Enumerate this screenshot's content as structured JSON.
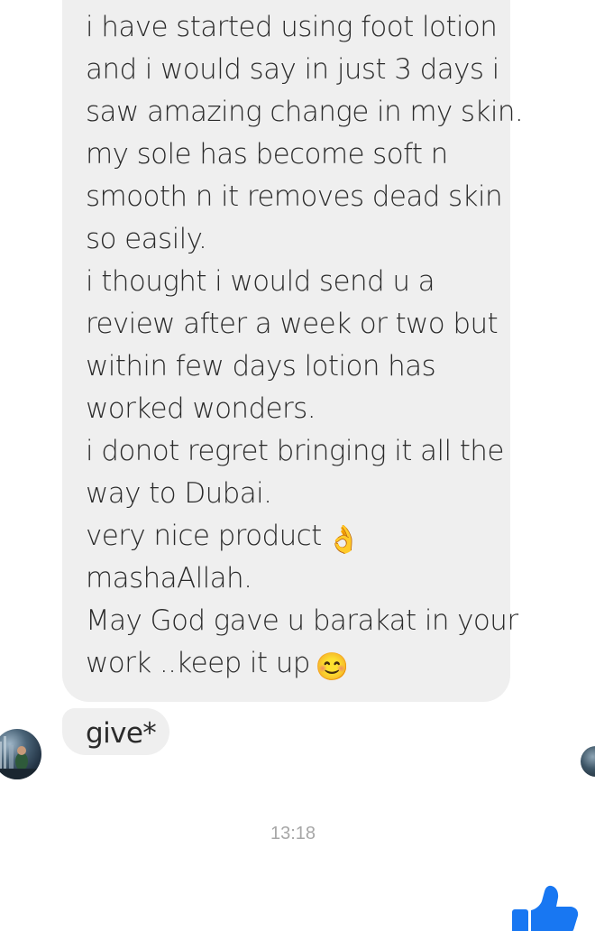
{
  "message": {
    "lines": [
      "i have started using foot lotion",
      "and i would say in just 3 days i",
      "saw amazing change in my skin.",
      "my sole has become soft n",
      "smooth n it removes dead skin",
      "so easily.",
      "i thought i would send u a",
      "review after a week or two but",
      "within few days lotion has",
      "worked wonders.",
      "i donot regret bringing it all the",
      "way to Dubai.",
      "very nice product",
      "mashaAllah.",
      "May God gave u barakat in your",
      "work ..keep it up"
    ],
    "emoji_ok": "👌",
    "emoji_smile": "😊"
  },
  "correction": {
    "text": "give*"
  },
  "timestamp": "13:18",
  "colors": {
    "bubble": "#efefef",
    "text": "#2b2b2b",
    "timestamp": "#a7a7a7",
    "like": "#1877f2"
  },
  "icons": {
    "like": "thumbs-up-icon",
    "avatar_left": "contact-avatar",
    "avatar_right": "seen-avatar"
  }
}
